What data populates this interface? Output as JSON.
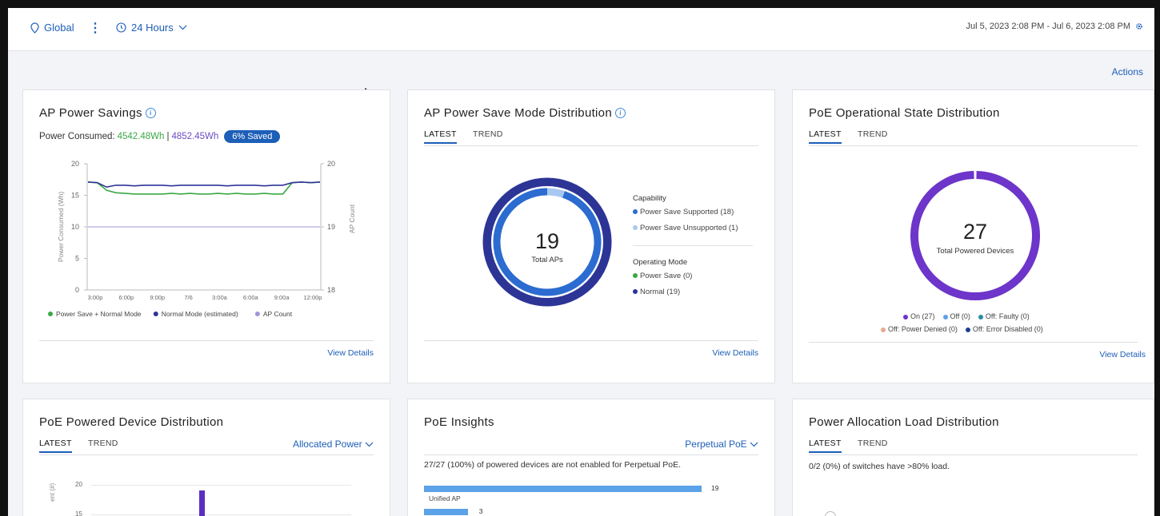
{
  "topbar": {
    "location": "Global",
    "time_window": "24 Hours",
    "date_range": "Jul 5, 2023 2:08 PM - Jul 6, 2023 2:08 PM"
  },
  "actions_label": "Actions",
  "cards": {
    "ap_power_savings": {
      "title": "AP Power Savings",
      "power_consumed_label": "Power Consumed:",
      "power_consumed_value": "4542.48Wh",
      "separator": "|",
      "power_estimated_value": "4852.45Wh",
      "saved_badge": "6% Saved",
      "view_details": "View Details",
      "legend": [
        "Power Save + Normal Mode",
        "Normal Mode (estimated)",
        "AP Count"
      ]
    },
    "ap_power_save_mode": {
      "title": "AP Power Save Mode Distribution",
      "tab_latest": "LATEST",
      "tab_trend": "TREND",
      "total_value": "19",
      "total_label": "Total APs",
      "capability_heading": "Capability",
      "capability_items": [
        "Power Save Supported (18)",
        "Power Save Unsupported (1)"
      ],
      "operating_heading": "Operating Mode",
      "operating_items": [
        "Power Save (0)",
        "Normal (19)"
      ],
      "view_details": "View Details"
    },
    "poe_operational": {
      "title": "PoE Operational State Distribution",
      "tab_latest": "LATEST",
      "tab_trend": "TREND",
      "total_value": "27",
      "total_label": "Total Powered Devices",
      "legend_row1": [
        "On (27)",
        "Off (0)",
        "Off: Faulty (0)"
      ],
      "legend_row2": [
        "Off: Power Denied (0)",
        "Off: Error Disabled (0)"
      ],
      "view_details": "View Details"
    },
    "poe_powered_device": {
      "title": "PoE Powered Device Distribution",
      "tab_latest": "LATEST",
      "tab_trend": "TREND",
      "dropdown": "Allocated Power",
      "y_tick_top": "20",
      "y_tick_2": "15",
      "y_axis_label": "ent (#)"
    },
    "poe_insights": {
      "title": "PoE Insights",
      "dropdown": "Perpetual PoE",
      "description": "27/27 (100%) of powered devices are not enabled for Perpetual PoE.",
      "bar1_label": "Unified AP",
      "bar1_value": "19",
      "bar2_value": "3"
    },
    "power_allocation": {
      "title": "Power Allocation Load Distribution",
      "tab_latest": "LATEST",
      "tab_trend": "TREND",
      "description": "0/2 (0%) of switches have >80% load."
    }
  },
  "colors": {
    "accent": "#1d5fb8",
    "green": "#3aa845",
    "navy": "#2c3596",
    "lavender": "#9d95d9",
    "purple": "#6d35c9",
    "blue_ring": "#2c6bd0",
    "light_blue": "#a7c8f0"
  },
  "chart_data": [
    {
      "type": "line",
      "title": "AP Power Savings",
      "xlabel": "",
      "ylabel": "Power Consumed (Wh)",
      "y2label": "AP Count",
      "x_ticks": [
        "3:00p",
        "6:00p",
        "9:00p",
        "7/6",
        "3:00a",
        "6:00a",
        "9:00a",
        "12:00p"
      ],
      "ylim": [
        0,
        20
      ],
      "y_ticks": [
        0,
        5,
        10,
        15,
        20
      ],
      "y2lim": [
        18,
        20
      ],
      "y2_ticks": [
        18,
        19,
        20
      ],
      "series": [
        {
          "name": "Power Save + Normal Mode",
          "values": [
            17.1,
            17.0,
            15.8,
            15.4,
            15.3,
            15.2,
            15.2,
            15.2,
            15.2,
            15.3,
            15.2,
            15.3,
            15.2,
            15.2,
            15.3,
            15.2,
            15.3,
            15.2,
            15.2,
            15.3,
            15.2,
            15.2,
            17.0,
            17.1,
            17.0,
            17.1
          ]
        },
        {
          "name": "Normal Mode (estimated)",
          "values": [
            17.1,
            17.0,
            16.3,
            16.6,
            16.6,
            16.5,
            16.6,
            16.6,
            16.6,
            16.5,
            16.6,
            16.6,
            16.6,
            16.6,
            16.6,
            16.5,
            16.6,
            16.6,
            16.6,
            16.5,
            16.6,
            16.6,
            17.0,
            17.1,
            17.0,
            17.1
          ]
        },
        {
          "name": "AP Count",
          "values": [
            19,
            19,
            19,
            19,
            19,
            19,
            19,
            19,
            19,
            19,
            19,
            19,
            19,
            19,
            19,
            19,
            19,
            19,
            19,
            19,
            19,
            19,
            19,
            19,
            19,
            19
          ]
        }
      ],
      "grid": false,
      "legend": "bottom"
    },
    {
      "type": "pie",
      "title": "AP Power Save Mode Distribution",
      "rings": [
        {
          "name": "Capability",
          "slices": [
            {
              "label": "Power Save Supported",
              "value": 18
            },
            {
              "label": "Power Save Unsupported",
              "value": 1
            }
          ]
        },
        {
          "name": "Operating Mode",
          "slices": [
            {
              "label": "Power Save",
              "value": 0
            },
            {
              "label": "Normal",
              "value": 19
            }
          ]
        }
      ]
    },
    {
      "type": "pie",
      "title": "PoE Operational State Distribution",
      "slices": [
        {
          "label": "On",
          "value": 27
        },
        {
          "label": "Off",
          "value": 0
        },
        {
          "label": "Off: Faulty",
          "value": 0
        },
        {
          "label": "Off: Power Denied",
          "value": 0
        },
        {
          "label": "Off: Error Disabled",
          "value": 0
        }
      ]
    },
    {
      "type": "bar",
      "title": "PoE Insights",
      "categories": [
        "Unified AP",
        ""
      ],
      "values": [
        19,
        3
      ]
    }
  ]
}
